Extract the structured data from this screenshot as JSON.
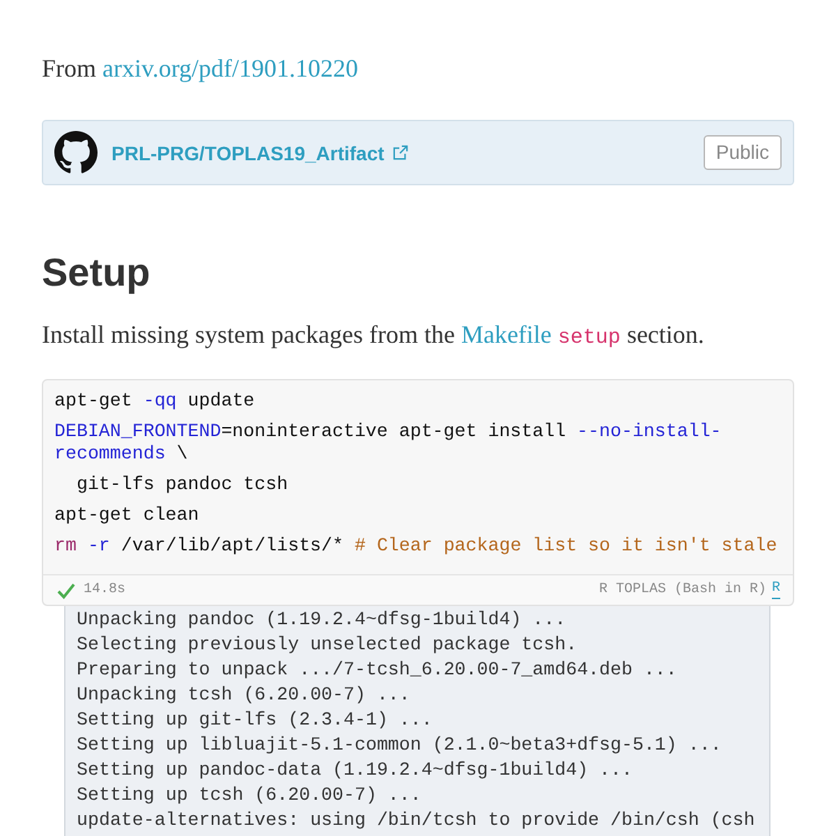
{
  "source": {
    "prefix": "From",
    "link": "arxiv.org/pdf/1901.10220"
  },
  "repo_card": {
    "name": "PRL-PRG/TOPLAS19_Artifact",
    "badge": "Public"
  },
  "heading": "Setup",
  "intro": [
    {
      "kind": "text",
      "text": "Install missing system packages from the"
    },
    {
      "kind": "link",
      "text": "Makefile"
    },
    {
      "kind": "code",
      "text": "setup"
    },
    {
      "kind": "text",
      "text": "section."
    }
  ],
  "code_cell": {
    "lines": [
      [
        {
          "kind": "plain",
          "text": "apt-get "
        },
        {
          "kind": "flag",
          "text": "-qq"
        },
        {
          "kind": "plain",
          "text": " update"
        }
      ],
      [
        {
          "kind": "variable",
          "text": "DEBIAN_FRONTEND"
        },
        {
          "kind": "plain",
          "text": "=noninteractive apt-get install "
        },
        {
          "kind": "flag",
          "text": "--no-install-recommends"
        },
        {
          "kind": "plain",
          "text": " \\"
        }
      ],
      [
        {
          "kind": "plain",
          "text": "  git-lfs pandoc tcsh"
        }
      ],
      [
        {
          "kind": "plain",
          "text": "apt-get clean"
        }
      ],
      [
        {
          "kind": "command",
          "text": "rm "
        },
        {
          "kind": "flag",
          "text": "-r"
        },
        {
          "kind": "plain",
          "text": " /var/lib/apt/lists/* "
        },
        {
          "kind": "comment",
          "text": "# Clear package list so it isn't stale"
        }
      ]
    ],
    "status": {
      "succeeded": true,
      "duration": "14.8s",
      "kernel": "R TOPLAS (Bash in R)",
      "language_link": "R"
    },
    "output": [
      "Unpacking pandoc (1.19.2.4~dfsg-1build4) ...",
      "Selecting previously unselected package tcsh.",
      "Preparing to unpack .../7-tcsh_6.20.00-7_amd64.deb ...",
      "Unpacking tcsh (6.20.00-7) ...",
      "Setting up git-lfs (2.3.4-1) ...",
      "Setting up libluajit-5.1-common (2.1.0~beta3+dfsg-5.1) ...",
      "Setting up pandoc-data (1.19.2.4~dfsg-1build4) ...",
      "Setting up tcsh (6.20.00-7) ...",
      "update-alternatives: using /bin/tcsh to provide /bin/csh (csh"
    ]
  }
}
